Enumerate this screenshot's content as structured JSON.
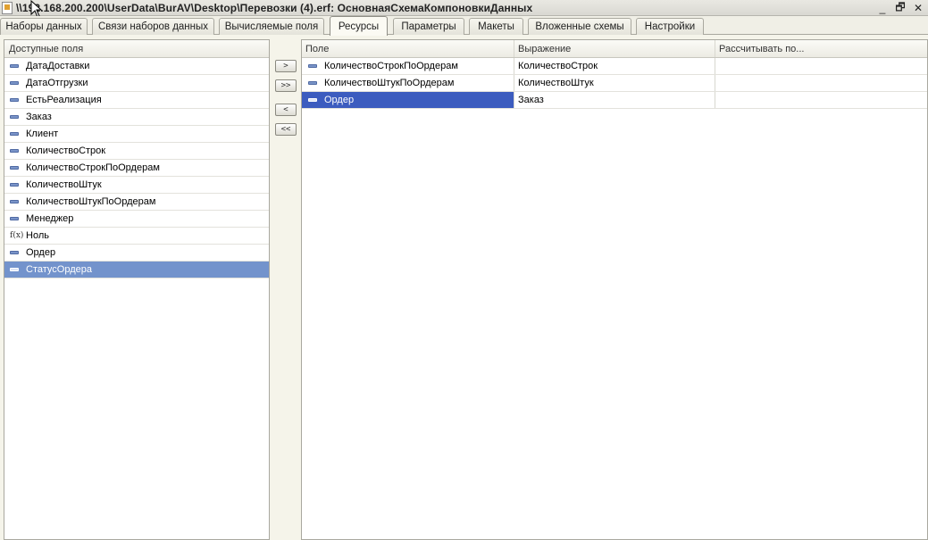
{
  "window": {
    "title": "\\\\192.168.200.200\\UserData\\BurAV\\Desktop\\Перевозки (4).erf: ОсновнаяСхемаКомпоновкиДанных",
    "minimize": "_",
    "restore": "🗗",
    "close": "✕"
  },
  "tabs": [
    {
      "label": "Наборы данных"
    },
    {
      "label": "Связи наборов данных"
    },
    {
      "label": "Вычисляемые поля"
    },
    {
      "label": "Ресурсы",
      "active": true
    },
    {
      "label": "Параметры"
    },
    {
      "label": "Макеты"
    },
    {
      "label": "Вложенные схемы"
    },
    {
      "label": "Настройки"
    }
  ],
  "available_fields": {
    "header": "Доступные поля",
    "items": [
      {
        "label": "ДатаДоставки",
        "icon": "field-icon"
      },
      {
        "label": "ДатаОтгрузки",
        "icon": "field-icon"
      },
      {
        "label": "ЕстьРеализация",
        "icon": "field-icon"
      },
      {
        "label": "Заказ",
        "icon": "field-icon"
      },
      {
        "label": "Клиент",
        "icon": "field-icon"
      },
      {
        "label": "КоличествоСтрок",
        "icon": "field-icon"
      },
      {
        "label": "КоличествоСтрокПоОрдерам",
        "icon": "field-icon"
      },
      {
        "label": "КоличествоШтук",
        "icon": "field-icon"
      },
      {
        "label": "КоличествоШтукПоОрдерам",
        "icon": "field-icon"
      },
      {
        "label": "Менеджер",
        "icon": "field-icon"
      },
      {
        "label": "Ноль",
        "icon": "function-icon",
        "glyph": "f(x)"
      },
      {
        "label": "Ордер",
        "icon": "field-icon"
      },
      {
        "label": "СтатусОрдера",
        "icon": "field-icon",
        "selected": true
      }
    ]
  },
  "move_buttons": {
    "add": ">",
    "add_all": ">>",
    "remove": "<",
    "remove_all": "<<"
  },
  "resources_table": {
    "columns": [
      "Поле",
      "Выражение",
      "Рассчитывать по..."
    ],
    "rows": [
      {
        "field": "КоличествоСтрокПоОрдерам",
        "expression": "КоличествоСтрок",
        "calc_by": ""
      },
      {
        "field": "КоличествоШтукПоОрдерам",
        "expression": "КоличествоШтук",
        "calc_by": ""
      },
      {
        "field": "Ордер",
        "expression": "Заказ",
        "calc_by": "",
        "selected": true
      }
    ]
  },
  "colors": {
    "selection_list": "#7393cc",
    "selection_grid": "#3c5cbf",
    "field_icon": "#7a94c8"
  }
}
